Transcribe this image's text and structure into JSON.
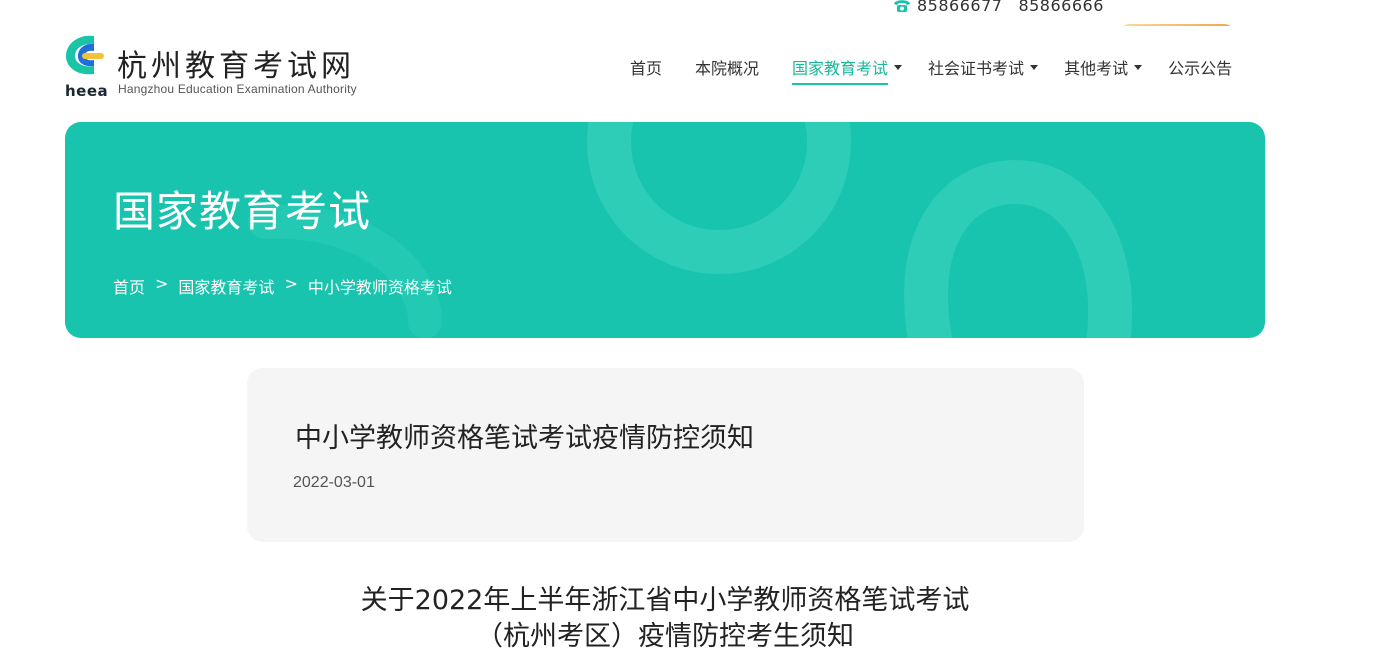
{
  "topbar": {
    "icon": "phone-icon",
    "phone1": "85866677",
    "phone2": "85866666"
  },
  "logo": {
    "cn": "杭州教育考试网",
    "en": "Hangzhou Education Examination Authority",
    "abbr": "heea"
  },
  "nav": [
    {
      "label": "首页"
    },
    {
      "label": "本院概况"
    },
    {
      "label": "国家教育考试"
    },
    {
      "label": "社会证书考试"
    },
    {
      "label": "其他考试"
    },
    {
      "label": "公示公告"
    }
  ],
  "banner": {
    "title": "国家教育考试",
    "breadcrumb": [
      "首页",
      "国家教育考试",
      "中小学教师资格考试"
    ],
    "separator": ">"
  },
  "article": {
    "title": "中小学教师资格笔试考试疫情防控须知",
    "date": "2022-03-01"
  },
  "notice": {
    "line1": "关于2022年上半年浙江省中小学教师资格笔试考试",
    "line2": "（杭州考区）疫情防控考生须知"
  },
  "colors": {
    "accent": "#18c4ad",
    "nav_active": "#19b89a",
    "card_bg": "#f5f5f5"
  }
}
